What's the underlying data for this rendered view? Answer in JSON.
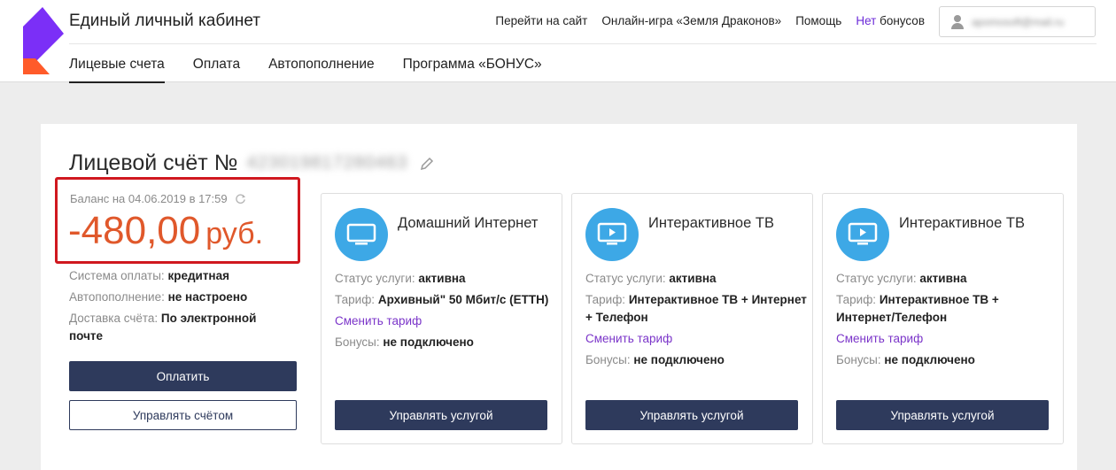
{
  "header": {
    "app_title": "Единый личный кабинет",
    "links": [
      "Перейти на сайт",
      "Онлайн-игра «Земля Драконов»",
      "Помощь"
    ],
    "bonus": {
      "prefix": "Нет",
      "suffix": "бонусов"
    },
    "user_email": "apomosoft@mail.ru",
    "brand_colors": {
      "purple": "#7b2ff7",
      "orange": "#ff5b2a"
    }
  },
  "nav": {
    "tabs": [
      "Лицевые счета",
      "Оплата",
      "Автопополнение",
      "Программа «БОНУС»"
    ],
    "active_index": 0
  },
  "account": {
    "title": "Лицевой счёт №",
    "number": "423019817280463",
    "balance_label": "Баланс на 04.06.2019 в 17:59",
    "balance_amount": "-480,00",
    "currency": "руб.",
    "balance_color": "#e0582b",
    "info": [
      {
        "label": "Система оплаты:",
        "value": "кредитная"
      },
      {
        "label": "Автопополнение:",
        "value": "не настроено"
      },
      {
        "label": "Доставка счёта:",
        "value": "По электронной почте"
      }
    ],
    "pay_button": "Оплатить",
    "manage_button": "Управлять счётом"
  },
  "services": [
    {
      "name": "Домашний Интернет",
      "icon": "monitor-icon",
      "status_label": "Статус услуги:",
      "status": "активна",
      "tariff_label": "Тариф:",
      "tariff": "Архивный\" 50 Мбит/с (ЕТТН)",
      "change_link": "Сменить тариф",
      "bonus_label": "Бонусы:",
      "bonus": "не подключено",
      "button": "Управлять услугой"
    },
    {
      "name": "Интерактивное ТВ",
      "icon": "tv-play-icon",
      "status_label": "Статус услуги:",
      "status": "активна",
      "tariff_label": "Тариф:",
      "tariff": "Интерактивное ТВ + Интернет + Телефон",
      "change_link": "Сменить тариф",
      "bonus_label": "Бонусы:",
      "bonus": "не подключено",
      "button": "Управлять услугой"
    },
    {
      "name": "Интерактивное ТВ",
      "icon": "tv-play-icon",
      "status_label": "Статус услуги:",
      "status": "активна",
      "tariff_label": "Тариф:",
      "tariff": "Интерактивное ТВ + Интернет/Телефон",
      "change_link": "Сменить тариф",
      "bonus_label": "Бонусы:",
      "bonus": "не подключено",
      "button": "Управлять услугой"
    }
  ]
}
